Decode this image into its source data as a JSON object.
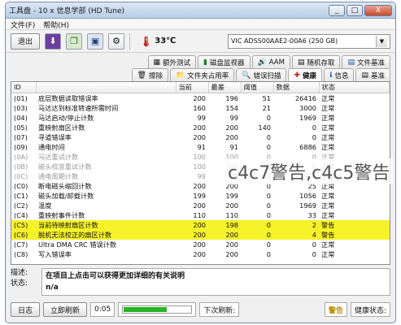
{
  "window": {
    "title": "工具盘 - 10 x 信息学部 (HD Tune)",
    "controls": [
      "_",
      "□",
      "X"
    ]
  },
  "menu": {
    "items": [
      "文件(F)",
      "帮助(H)"
    ]
  },
  "toolbar": {
    "exit_label": "退出",
    "temperature": "33℃",
    "drive": "VIC ADSS00AAE2-00A6 (250 GB)"
  },
  "tabs": {
    "row1": [
      {
        "label": "文件基准",
        "icon": "file-benchmark-icon"
      },
      {
        "label": "随机存取",
        "icon": "random-access-icon"
      },
      {
        "label": "AAM",
        "icon": "aam-icon"
      },
      {
        "label": "磁盘监视器",
        "icon": "disk-monitor-icon"
      },
      {
        "label": "额外测试",
        "icon": "extra-tests-icon"
      }
    ],
    "row2": [
      {
        "label": "基准",
        "icon": "benchmark-icon"
      },
      {
        "label": "信息",
        "icon": "info-icon"
      },
      {
        "label": "健康",
        "icon": "health-icon",
        "active": true
      },
      {
        "label": "错误扫描",
        "icon": "error-scan-icon"
      },
      {
        "label": "文件夹占用率",
        "icon": "folder-usage-icon"
      },
      {
        "label": "擦除",
        "icon": "erase-icon"
      }
    ]
  },
  "health_table": {
    "columns": [
      "ID",
      "",
      "当前",
      "最差",
      "阈值",
      "数据",
      "状态"
    ],
    "rows": [
      {
        "id": "(01)",
        "name": "底层数据读取错误率",
        "cur": "200",
        "worst": "196",
        "thr": "51",
        "data": "26416",
        "status": "正常"
      },
      {
        "id": "(03)",
        "name": "马达达到标准转速所需时间",
        "cur": "160",
        "worst": "154",
        "thr": "21",
        "data": "3000",
        "status": "正常"
      },
      {
        "id": "(04)",
        "name": "马达启动/停止计数",
        "cur": "99",
        "worst": "99",
        "thr": "0",
        "data": "1969",
        "status": "正常"
      },
      {
        "id": "(05)",
        "name": "重映射扇区计数",
        "cur": "200",
        "worst": "200",
        "thr": "140",
        "data": "0",
        "status": "正常"
      },
      {
        "id": "(07)",
        "name": "寻道错误率",
        "cur": "200",
        "worst": "200",
        "thr": "0",
        "data": "0",
        "status": "正常"
      },
      {
        "id": "(09)",
        "name": "通电时间",
        "cur": "91",
        "worst": "91",
        "thr": "0",
        "data": "6886",
        "status": "正常"
      },
      {
        "id": "(0A)",
        "name": "马达重试计数",
        "cur": "100",
        "worst": "100",
        "thr": "0",
        "data": "0",
        "status": "正常",
        "dim": true
      },
      {
        "id": "(0B)",
        "name": "磁头校准重试计数",
        "cur": "100",
        "worst": "100",
        "thr": "0",
        "data": "0",
        "status": "正常",
        "dim": true
      },
      {
        "id": "(0C)",
        "name": "通电周期计数",
        "cur": "99",
        "worst": "99",
        "thr": "0",
        "data": "1910",
        "status": "正常",
        "dim": true
      },
      {
        "id": "(C0)",
        "name": "断电磁头缩回计数",
        "cur": "200",
        "worst": "200",
        "thr": "0",
        "data": "25",
        "status": "正常"
      },
      {
        "id": "(C1)",
        "name": "磁头加载/卸载计数",
        "cur": "199",
        "worst": "199",
        "thr": "0",
        "data": "1056",
        "status": "正常"
      },
      {
        "id": "(C2)",
        "name": "温度",
        "cur": "200",
        "worst": "200",
        "thr": "0",
        "data": "1969",
        "status": "正常"
      },
      {
        "id": "(C4)",
        "name": "重映射事件计数",
        "cur": "110",
        "worst": "110",
        "thr": "0",
        "data": "33",
        "status": "正常"
      },
      {
        "id": "(C5)",
        "name": "当前待映射扇区计数",
        "cur": "200",
        "worst": "198",
        "thr": "0",
        "data": "2",
        "status": "警告",
        "warn": true
      },
      {
        "id": "(C6)",
        "name": "脱机无法校正的扇区计数",
        "cur": "200",
        "worst": "200",
        "thr": "0",
        "data": "4",
        "status": "警告",
        "warn": true
      },
      {
        "id": "(C7)",
        "name": "Ultra DMA CRC 错误计数",
        "cur": "200",
        "worst": "200",
        "thr": "0",
        "data": "0",
        "status": "正常"
      },
      {
        "id": "(C8)",
        "name": "写入错误率",
        "cur": "200",
        "worst": "200",
        "thr": "0",
        "data": "0",
        "status": "正常"
      }
    ]
  },
  "description": {
    "label_desc": "描述:",
    "label_status": "状态:",
    "text": "在项目上点击可以获得更加详细的有关说明",
    "status_value": "n/a"
  },
  "statusbar": {
    "health_label": "健康状态:",
    "health_value": "警告",
    "next_update_label": "下次刷新:",
    "timer": "0:05",
    "progress_fraction": 0.65,
    "refresh_button": "立即刷新",
    "log_button": "日志"
  },
  "overlay": {
    "watermark": "c4c7警告,c4c5警告"
  },
  "colors": {
    "warning_row": "#f6f22a",
    "progress": "#26b426"
  }
}
